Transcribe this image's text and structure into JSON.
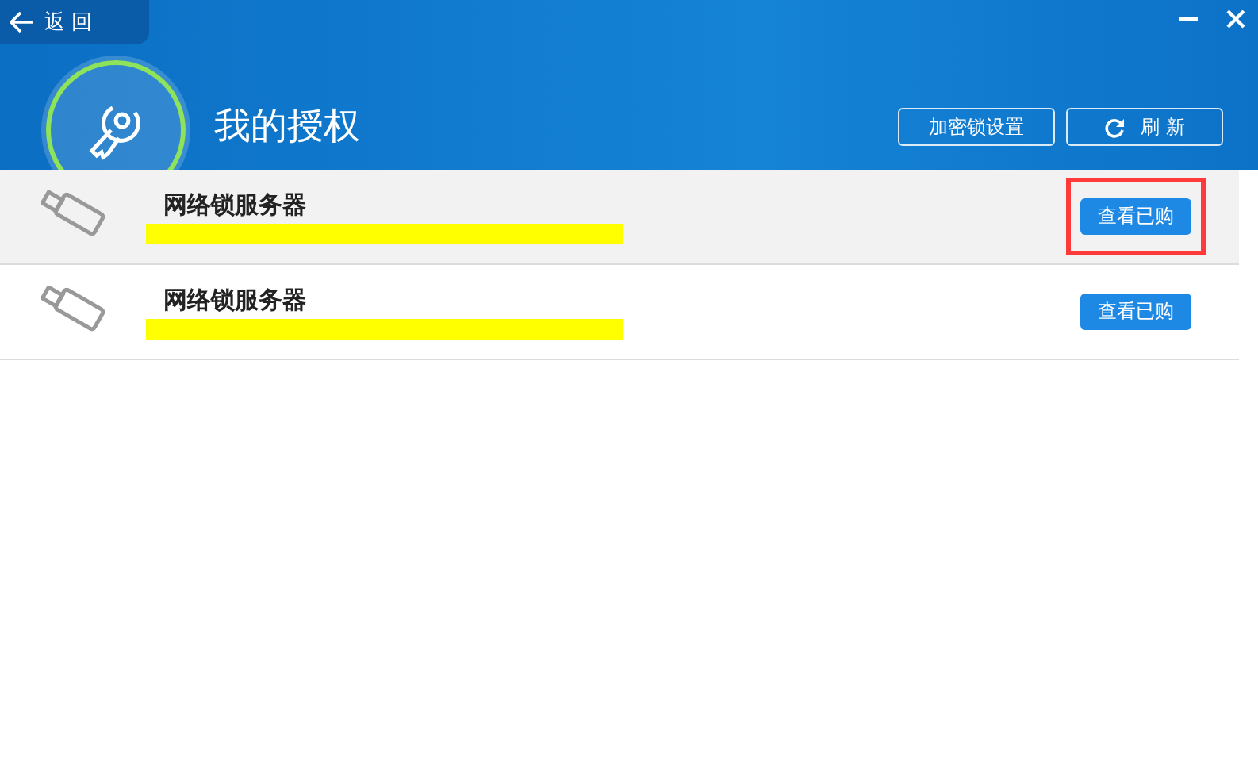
{
  "back_button": {
    "label": "返 回"
  },
  "title": "我的授权",
  "header_buttons": [
    {
      "kind": "settings",
      "label": "加密锁设置"
    },
    {
      "kind": "refresh",
      "label": "刷 新"
    }
  ],
  "rows": [
    {
      "name": "网络锁服务器",
      "selected": true,
      "button": "查看已购",
      "highlighted": true
    },
    {
      "name": "网络锁服务器",
      "selected": false,
      "button": "查看已购",
      "highlighted": false
    }
  ]
}
